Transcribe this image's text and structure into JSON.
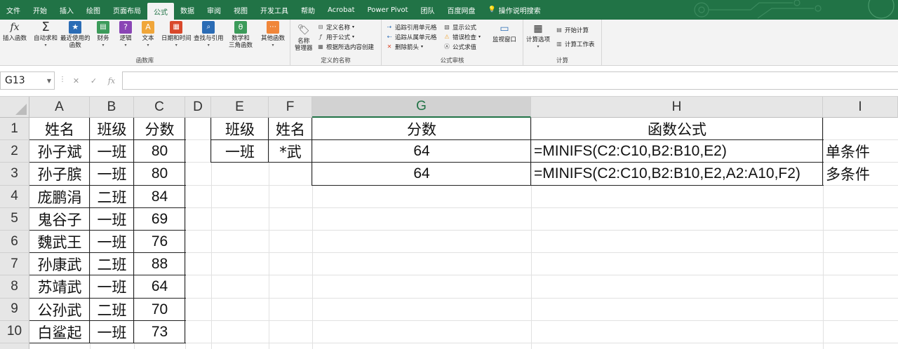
{
  "menu": {
    "tabs": [
      "文件",
      "开始",
      "插入",
      "绘图",
      "页面布局",
      "公式",
      "数据",
      "审阅",
      "视图",
      "开发工具",
      "帮助",
      "Acrobat",
      "Power Pivot",
      "团队",
      "百度网盘"
    ],
    "active_tab": "公式",
    "search_label": "操作说明搜索"
  },
  "ribbon": {
    "function_library": {
      "label": "函数库",
      "insert_function": "插入函数",
      "autosum": "自动求和",
      "recent_line1": "最近使用的",
      "recent_line2": "函数",
      "financial": "财务",
      "logical": "逻辑",
      "text": "文本",
      "datetime": "日期和时间",
      "lookup": "查找与引用",
      "math_line1": "数学和",
      "math_line2": "三角函数",
      "other": "其他函数"
    },
    "defined_names": {
      "label": "定义的名称",
      "name_manager_line1": "名称",
      "name_manager_line2": "管理器",
      "define_name": "定义名称",
      "use_in_formula": "用于公式",
      "create_from_selection": "根据所选内容创建"
    },
    "formula_auditing": {
      "label": "公式审核",
      "trace_precedents": "追踪引用单元格",
      "trace_dependents": "追踪从属单元格",
      "remove_arrows": "删除箭头",
      "show_formulas": "显示公式",
      "error_checking": "错误检查",
      "evaluate_formula": "公式求值",
      "watch_window": "监视窗口"
    },
    "calculation": {
      "label": "计算",
      "calc_options": "计算选项",
      "calc_now": "开始计算",
      "calc_sheet": "计算工作表"
    }
  },
  "formula_bar": {
    "name_box": "G13",
    "formula": ""
  },
  "columns": [
    "A",
    "B",
    "C",
    "D",
    "E",
    "F",
    "G",
    "H",
    "I"
  ],
  "selected_column": "G",
  "rows": [
    "1",
    "2",
    "3",
    "4",
    "5",
    "6",
    "7",
    "8",
    "9",
    "10"
  ],
  "table_main": {
    "headers": [
      "姓名",
      "班级",
      "分数"
    ],
    "rows": [
      [
        "孙子斌",
        "一班",
        "80"
      ],
      [
        "孙子膑",
        "一班",
        "80"
      ],
      [
        "庞鹏涓",
        "二班",
        "84"
      ],
      [
        "鬼谷子",
        "一班",
        "69"
      ],
      [
        "魏武王",
        "一班",
        "76"
      ],
      [
        "孙康武",
        "二班",
        "88"
      ],
      [
        "苏靖武",
        "一班",
        "64"
      ],
      [
        "公孙武",
        "二班",
        "70"
      ],
      [
        "白鲨起",
        "一班",
        "73"
      ]
    ]
  },
  "table_criteria": {
    "headers": [
      "班级",
      "姓名"
    ],
    "row": [
      "一班",
      "*武"
    ]
  },
  "table_results": {
    "headers": [
      "分数",
      "函数公式"
    ],
    "rows": [
      [
        "64",
        "=MINIFS(C2:C10,B2:B10,E2)"
      ],
      [
        "64",
        "=MINIFS(C2:C10,B2:B10,E2,A2:A10,F2)"
      ]
    ]
  },
  "notes": [
    "单条件",
    "多条件"
  ],
  "colors": {
    "brand": "#217346",
    "header_bg": "#e6e6e6",
    "ribbon_bg": "#f3f3f3"
  }
}
